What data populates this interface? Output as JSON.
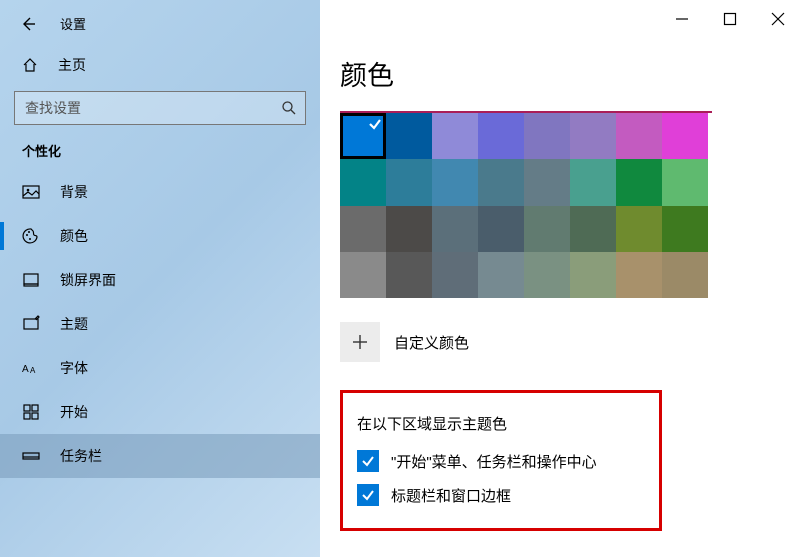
{
  "window_title": "设置",
  "home_label": "主页",
  "search": {
    "placeholder": "查找设置"
  },
  "section": "个性化",
  "sidebar": {
    "items": [
      {
        "label": "背景"
      },
      {
        "label": "颜色"
      },
      {
        "label": "锁屏界面"
      },
      {
        "label": "主题"
      },
      {
        "label": "字体"
      },
      {
        "label": "开始"
      },
      {
        "label": "任务栏"
      }
    ]
  },
  "main": {
    "heading": "颜色",
    "palette_colors": [
      "#0078d7",
      "#005a9e",
      "#8f8ad8",
      "#6a6ad8",
      "#8076c0",
      "#927bc2",
      "#c35bc0",
      "#e03fd8",
      "#038387",
      "#2d7d9a",
      "#4188b0",
      "#4a7a8c",
      "#647c87",
      "#49a08f",
      "#10893e",
      "#5fba6f",
      "#6b6b6b",
      "#4c4a48",
      "#5b6f7a",
      "#4a5d6b",
      "#617b70",
      "#4f6b55",
      "#6f8b2e",
      "#3e7a1f",
      "#8a8a8a",
      "#585858",
      "#5f6d78",
      "#768a91",
      "#7a9182",
      "#8a9d7a",
      "#a8916b",
      "#9b8a67"
    ],
    "selected_index": 0,
    "custom_label": "自定义颜色",
    "accent_section_title": "在以下区域显示主题色",
    "checks": [
      {
        "label": "\"开始\"菜单、任务栏和操作中心",
        "checked": true
      },
      {
        "label": "标题栏和窗口边框",
        "checked": true
      }
    ]
  }
}
